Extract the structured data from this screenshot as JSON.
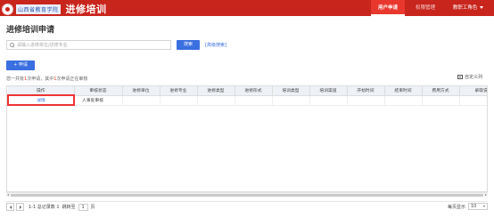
{
  "header": {
    "school_name": "山西省教育学院",
    "app_title": "进修培训",
    "nav": {
      "user_apply": "用户申请",
      "permission": "权限管理",
      "current_user": "教职工角色"
    }
  },
  "page": {
    "title": "进修培训申请"
  },
  "search": {
    "placeholder": "请输入进修单位/进修专业",
    "button": "搜索",
    "advanced": "[高级搜索]"
  },
  "toolbar": {
    "apply_label": "+ 申请",
    "summary_pre": "您一共有",
    "summary_count_1": "1",
    "summary_mid": "次申请，其中",
    "summary_count_2": "1",
    "summary_post": "次申请正在审核",
    "column_custom": "自定义列"
  },
  "table": {
    "headers": [
      "操作",
      "审核状态",
      "进修单位",
      "进修专业",
      "进修类型",
      "进修形式",
      "培训类型",
      "培训渠道",
      "开始时间",
      "结束时间",
      "费用方式",
      "录取说明"
    ],
    "rows": [
      [
        "详情",
        "人事处审核",
        "",
        "",
        "",
        "",
        "",
        "",
        "",
        "",
        "",
        ""
      ]
    ]
  },
  "pagination": {
    "range": "1-1 总记录数 1",
    "jump_label": "跳转至",
    "page_value": "1",
    "page_unit": "页",
    "per_page_label": "每页显示",
    "per_page_value": "10"
  },
  "colors": {
    "brand_red": "#c8251d",
    "primary_blue": "#3a6fe0"
  }
}
